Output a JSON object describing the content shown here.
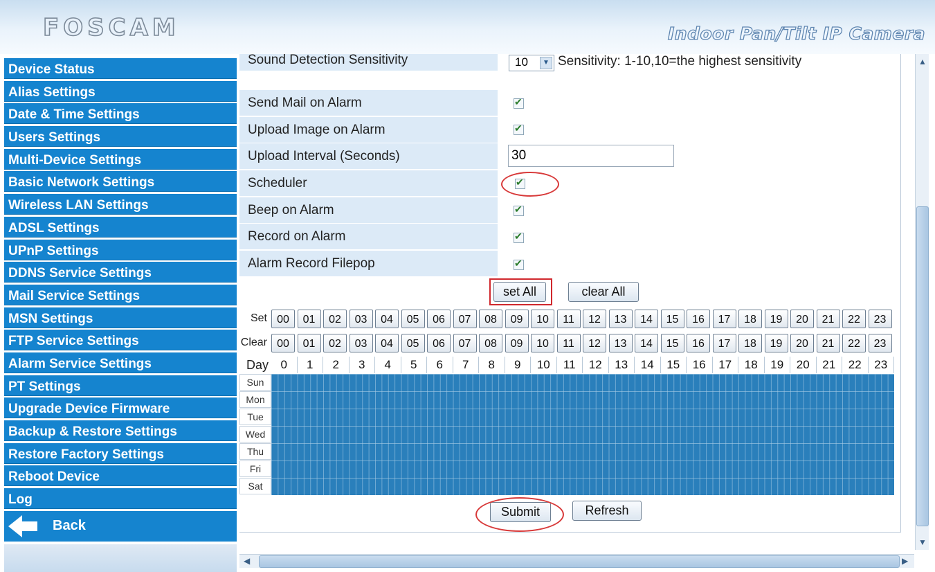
{
  "header": {
    "logo": "FOSCAM",
    "product_title": "Indoor Pan/Tilt IP Camera"
  },
  "sidebar": {
    "items": [
      {
        "label": "Device Status"
      },
      {
        "label": "Alias Settings"
      },
      {
        "label": "Date & Time Settings"
      },
      {
        "label": "Users Settings"
      },
      {
        "label": "Multi-Device Settings"
      },
      {
        "label": "Basic Network Settings"
      },
      {
        "label": "Wireless LAN Settings"
      },
      {
        "label": "ADSL Settings"
      },
      {
        "label": "UPnP Settings"
      },
      {
        "label": "DDNS Service Settings"
      },
      {
        "label": "Mail Service Settings"
      },
      {
        "label": "MSN Settings"
      },
      {
        "label": "FTP Service Settings"
      },
      {
        "label": "Alarm Service Settings"
      },
      {
        "label": "PT Settings"
      },
      {
        "label": "Upgrade Device Firmware"
      },
      {
        "label": "Backup & Restore Settings"
      },
      {
        "label": "Restore Factory Settings"
      },
      {
        "label": "Reboot Device"
      },
      {
        "label": "Log"
      }
    ],
    "back_label": "Back"
  },
  "form": {
    "sound_sensitivity": {
      "label": "Sound Detection Sensitivity",
      "value": "10",
      "hint": "Sensitivity: 1-10,10=the highest sensitivity"
    },
    "send_mail": {
      "label": "Send Mail on Alarm",
      "checked": true
    },
    "upload_image": {
      "label": "Upload Image on Alarm",
      "checked": true
    },
    "upload_interval": {
      "label": "Upload Interval (Seconds)",
      "value": "30"
    },
    "scheduler": {
      "label": "Scheduler",
      "checked": true
    },
    "beep": {
      "label": "Beep on Alarm",
      "checked": true
    },
    "record": {
      "label": "Record on Alarm",
      "checked": true
    },
    "filepop": {
      "label": "Alarm Record Filepop",
      "checked": true
    }
  },
  "schedule": {
    "set_all_label": "set All",
    "clear_all_label": "clear All",
    "set_row_label": "Set",
    "clear_row_label": "Clear",
    "day_row_label": "Day",
    "hour_buttons": [
      "00",
      "01",
      "02",
      "03",
      "04",
      "05",
      "06",
      "07",
      "08",
      "09",
      "10",
      "11",
      "12",
      "13",
      "14",
      "15",
      "16",
      "17",
      "18",
      "19",
      "20",
      "21",
      "22",
      "23"
    ],
    "hours": [
      "0",
      "1",
      "2",
      "3",
      "4",
      "5",
      "6",
      "7",
      "8",
      "9",
      "10",
      "11",
      "12",
      "13",
      "14",
      "15",
      "16",
      "17",
      "18",
      "19",
      "20",
      "21",
      "22",
      "23"
    ],
    "days": [
      "Sun",
      "Mon",
      "Tue",
      "Wed",
      "Thu",
      "Fri",
      "Sat"
    ],
    "all_selected": true,
    "selected_color": "#2a7fbb"
  },
  "actions": {
    "submit_label": "Submit",
    "refresh_label": "Refresh"
  },
  "colors": {
    "nav_bg": "#1584cf",
    "label_bg": "#dceaf7",
    "highlight_red": "#d0282d"
  }
}
